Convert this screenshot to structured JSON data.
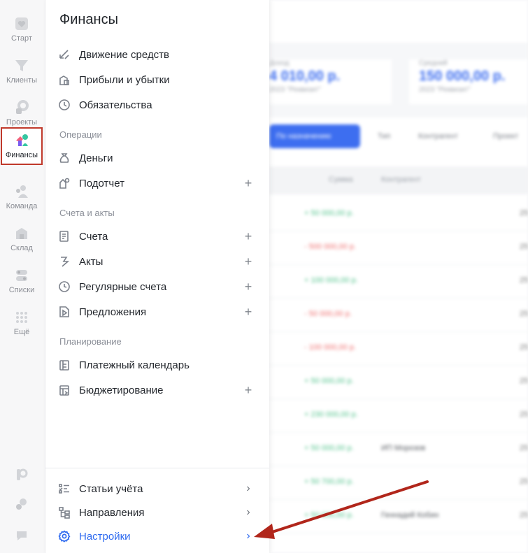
{
  "rail": {
    "items": [
      {
        "label": "Старт",
        "icon": "heart-icon"
      },
      {
        "label": "Клиенты",
        "icon": "funnel-icon"
      },
      {
        "label": "Проекты",
        "icon": "projects-icon"
      },
      {
        "label": "Финансы",
        "icon": "finance-icon"
      },
      {
        "label": "Команда",
        "icon": "team-icon"
      },
      {
        "label": "Склад",
        "icon": "warehouse-icon"
      },
      {
        "label": "Списки",
        "icon": "lists-icon"
      },
      {
        "label": "Ещё",
        "icon": "more-grid-icon"
      }
    ],
    "active_index": 3,
    "active_outline_color": "#c0392b"
  },
  "panel": {
    "title": "Финансы",
    "top_items": [
      {
        "label": "Движение средств",
        "icon": "transfer-arrows-icon"
      },
      {
        "label": "Прибыли и убытки",
        "icon": "profit-loss-icon"
      },
      {
        "label": "Обязательства",
        "icon": "obligations-icon"
      }
    ],
    "sections": [
      {
        "title": "Операции",
        "items": [
          {
            "label": "Деньги",
            "icon": "money-bag-icon",
            "plus": false
          },
          {
            "label": "Подотчет",
            "icon": "accountable-icon",
            "plus": true
          }
        ]
      },
      {
        "title": "Счета и акты",
        "items": [
          {
            "label": "Счета",
            "icon": "invoice-icon",
            "plus": true
          },
          {
            "label": "Акты",
            "icon": "acts-icon",
            "plus": true
          },
          {
            "label": "Регулярные счета",
            "icon": "clock-icon",
            "plus": true
          },
          {
            "label": "Предложения",
            "icon": "proposal-icon",
            "plus": true
          }
        ]
      },
      {
        "title": "Планирование",
        "items": [
          {
            "label": "Платежный календарь",
            "icon": "calendar-icon",
            "plus": false
          },
          {
            "label": "Бюджетирование",
            "icon": "budget-icon",
            "plus": true
          }
        ]
      }
    ],
    "plus_symbol": "+",
    "chevron_symbol": "›",
    "footer_items": [
      {
        "label": "Статьи учёта",
        "icon": "list-check-icon"
      },
      {
        "label": "Направления",
        "icon": "directions-tree-icon"
      },
      {
        "label": "Настройки",
        "icon": "gear-icon"
      }
    ],
    "accent_color": "#2f6bf0"
  },
  "background": {
    "cards": [
      {
        "title": "Доход",
        "value": "4 010,00 р.",
        "sub": "2023 \"Реквизит\""
      },
      {
        "title": "Средний",
        "value": "150 000,00 р.",
        "sub": "2023 \"Реквизит\""
      }
    ],
    "filter_button": "По назначению",
    "chips": [
      "Тип",
      "Контрагент",
      "Проект"
    ],
    "columns": [
      "Сумма",
      "Контрагент"
    ],
    "rows": [
      {
        "amount": "+ 50 000,00 р.",
        "sign": "pos",
        "counterparty": "",
        "tail": "25"
      },
      {
        "amount": "- 500 000,00 р.",
        "sign": "neg",
        "counterparty": "",
        "tail": "25"
      },
      {
        "amount": "+ 100 000,00 р.",
        "sign": "pos",
        "counterparty": "",
        "tail": "25"
      },
      {
        "amount": "- 50 000,00 р.",
        "sign": "neg",
        "counterparty": "",
        "tail": "25"
      },
      {
        "amount": "- 100 000,00 р.",
        "sign": "neg",
        "counterparty": "",
        "tail": "25"
      },
      {
        "amount": "+ 50 000,00 р.",
        "sign": "pos",
        "counterparty": "",
        "tail": "25"
      },
      {
        "amount": "+ 230 000,00 р.",
        "sign": "pos",
        "counterparty": "",
        "tail": "25"
      },
      {
        "amount": "+ 50 000,00 р.",
        "sign": "pos",
        "counterparty": "ИП Морозов",
        "tail": "25"
      },
      {
        "amount": "+ 50 700,00 р.",
        "sign": "pos",
        "counterparty": "",
        "tail": "25"
      },
      {
        "amount": "+ 50 000,00 р.",
        "sign": "pos",
        "counterparty": "Геннадий Кобин",
        "tail": "25"
      }
    ]
  }
}
